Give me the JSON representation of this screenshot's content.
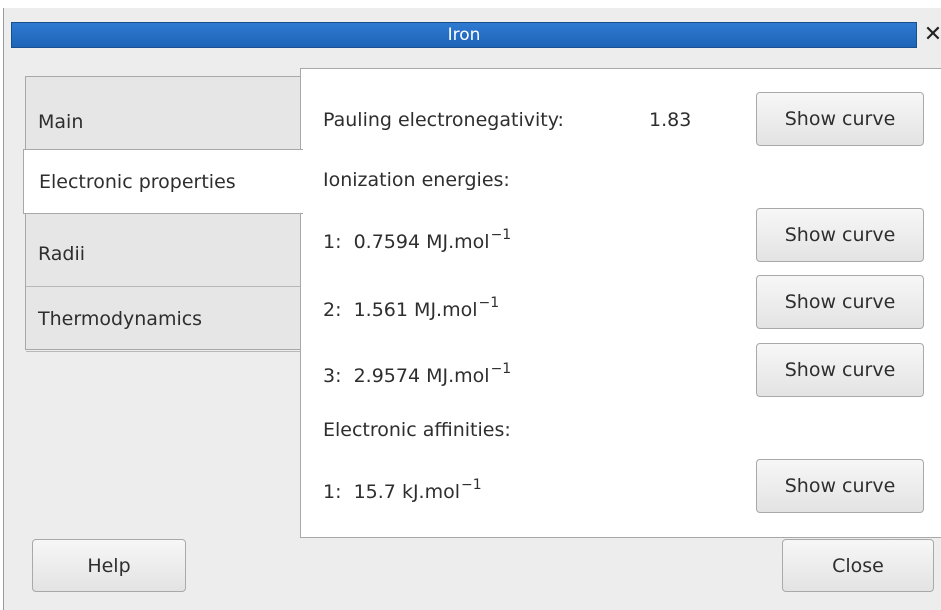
{
  "window": {
    "title": "Iron",
    "close_glyph": "✕"
  },
  "tabs": [
    {
      "label": "Main",
      "active": false
    },
    {
      "label": "Electronic properties",
      "active": true
    },
    {
      "label": "Radii",
      "active": false
    },
    {
      "label": "Thermodynamics",
      "active": false
    }
  ],
  "electronic": {
    "electronegativity_label": "Pauling electronegativity:",
    "electronegativity_value": "1.83",
    "ionization_heading": "Ionization energies:",
    "ionization": [
      {
        "index": "1:",
        "value": "0.7594",
        "unit": "MJ.mol",
        "exponent": "−1"
      },
      {
        "index": "2:",
        "value": "1.561",
        "unit": "MJ.mol",
        "exponent": "−1"
      },
      {
        "index": "3:",
        "value": "2.9574",
        "unit": "MJ.mol",
        "exponent": "−1"
      }
    ],
    "affinity_heading": "Electronic affinities:",
    "affinity": [
      {
        "index": "1:",
        "value": "15.7",
        "unit": "kJ.mol",
        "exponent": "−1"
      }
    ],
    "show_curve_label": "Show curve"
  },
  "footer": {
    "help_label": "Help",
    "close_label": "Close"
  }
}
